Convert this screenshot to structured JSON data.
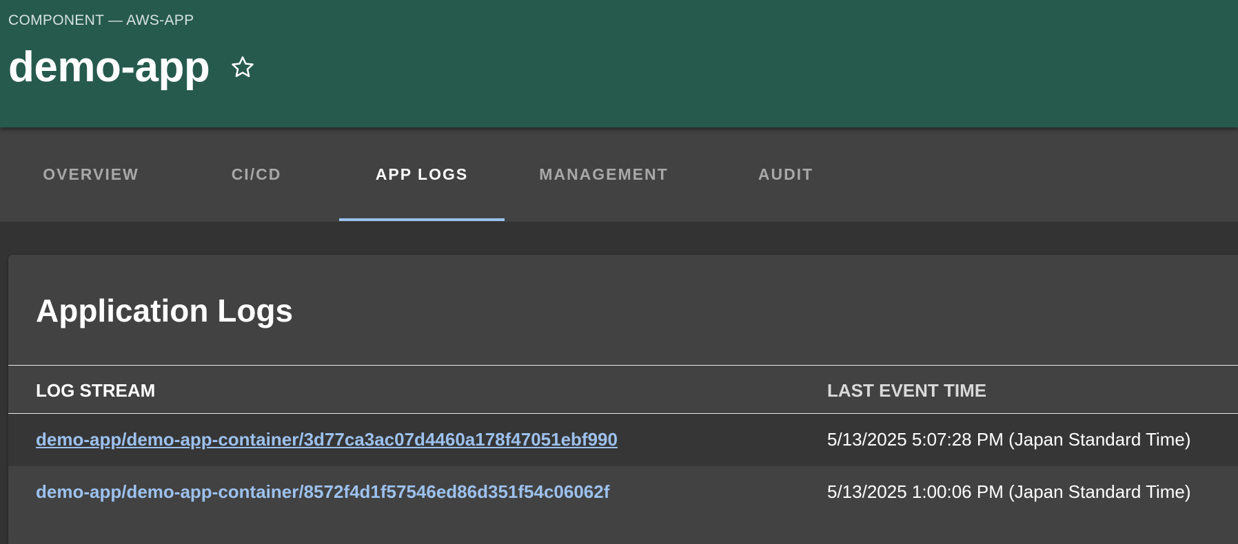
{
  "header": {
    "breadcrumb": "COMPONENT — AWS-APP",
    "title": "demo-app",
    "favorite_icon": "star-outline-icon",
    "background": "#265a4d"
  },
  "tabs": [
    {
      "label": "OVERVIEW",
      "active": false
    },
    {
      "label": "CI/CD",
      "active": false
    },
    {
      "label": "APP LOGS",
      "active": true
    },
    {
      "label": "MANAGEMENT",
      "active": false
    },
    {
      "label": "AUDIT",
      "active": false
    }
  ],
  "accent": "#9cc1ee",
  "logs": {
    "title": "Application Logs",
    "columns": [
      "LOG STREAM",
      "LAST EVENT TIME"
    ],
    "rows": [
      {
        "stream": "demo-app/demo-app-container/3d77ca3ac07d4460a178f47051ebf990",
        "time": "5/13/2025 5:07:28 PM (Japan Standard Time)"
      },
      {
        "stream": "demo-app/demo-app-container/8572f4d1f57546ed86d351f54c06062f",
        "time": "5/13/2025 1:00:06 PM (Japan Standard Time)"
      }
    ]
  }
}
